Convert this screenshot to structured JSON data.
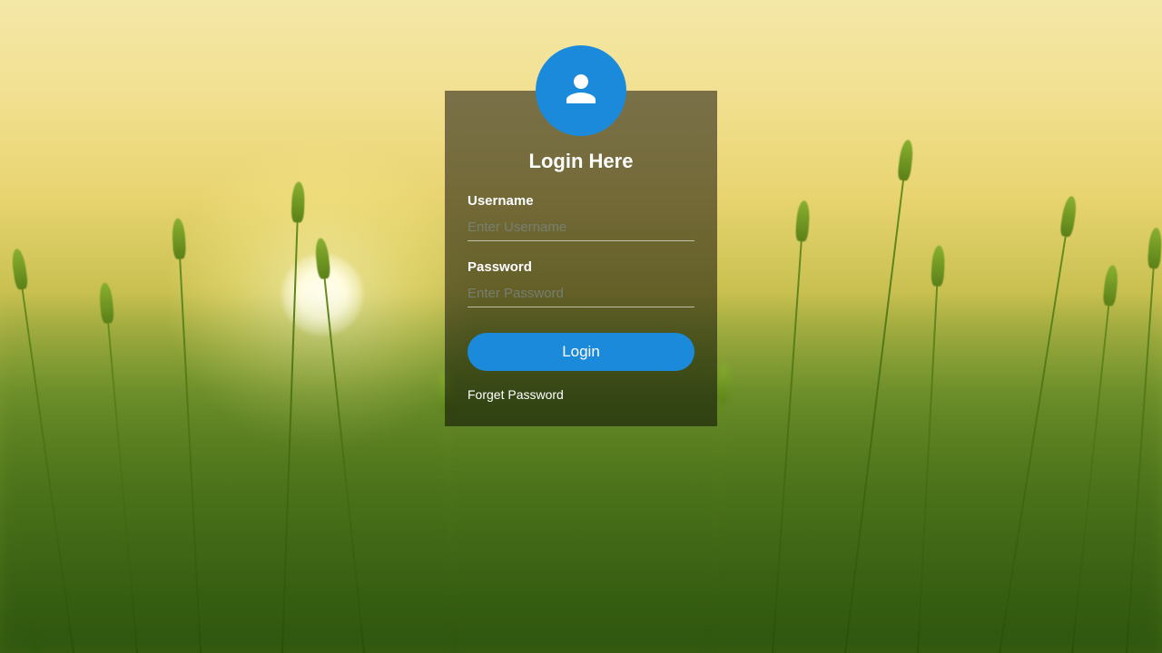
{
  "login": {
    "title": "Login Here",
    "username_label": "Username",
    "username_placeholder": "Enter Username",
    "username_value": "",
    "password_label": "Password",
    "password_placeholder": "Enter Password",
    "password_value": "",
    "button_label": "Login",
    "forget_link": "Forget Password"
  },
  "colors": {
    "accent": "#1c8adb"
  },
  "icons": {
    "avatar": "person-icon"
  }
}
